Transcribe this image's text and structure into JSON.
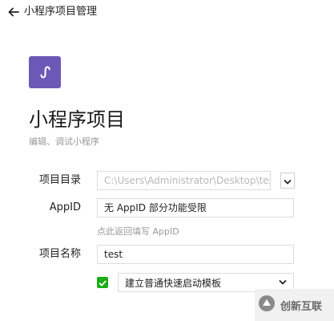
{
  "header": {
    "back_icon": "arrow-left-icon",
    "title": "小程序项目管理"
  },
  "logo": {
    "icon": "mini-program-logo-icon",
    "color": "#6b59b8"
  },
  "page": {
    "title": "小程序项目",
    "subtitle": "编辑、调试小程序"
  },
  "form": {
    "project_dir": {
      "label": "项目目录",
      "value": "C:\\Users\\Administrator\\Desktop\\test",
      "dropdown_icon": "chevron-down-icon"
    },
    "appid": {
      "label": "AppID",
      "value": "无 AppID 部分功能受限",
      "hint": "点此返回填写 AppID"
    },
    "project_name": {
      "label": "项目名称",
      "value": "test"
    },
    "template": {
      "checked": true,
      "checkbox_color": "#1aad19",
      "selected": "建立普通快速启动模板",
      "dropdown_icon": "chevron-down-icon"
    }
  },
  "watermark": {
    "text": "创新互联"
  }
}
